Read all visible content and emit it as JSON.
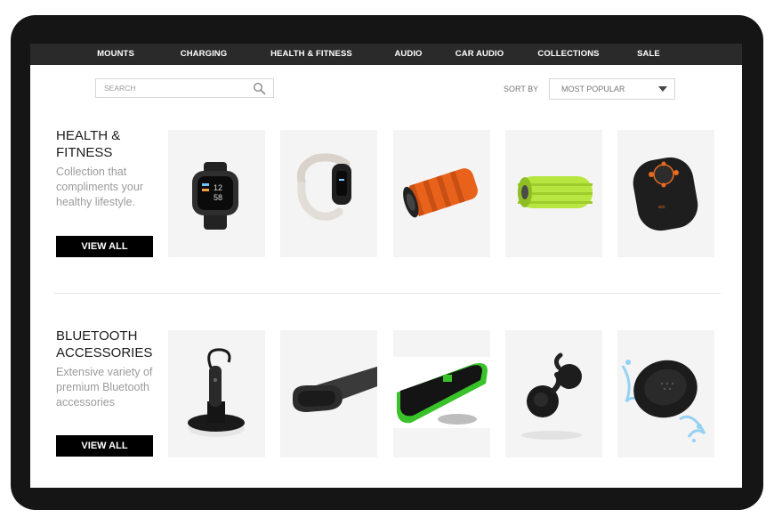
{
  "nav": {
    "items": [
      "MOUNTS",
      "CHARGING",
      "HEALTH & FITNESS",
      "AUDIO",
      "CAR AUDIO",
      "COLLECTIONS",
      "SALE"
    ]
  },
  "search": {
    "placeholder": "SEARCH"
  },
  "sort": {
    "label": "SORT BY",
    "selected": "MOST POPULAR"
  },
  "sections": [
    {
      "title_line1": "HEALTH &",
      "title_line2": "FITNESS",
      "desc_lines": [
        "Collection that",
        "compliments your",
        "healthy lifestyle."
      ],
      "button": "VIEW ALL",
      "products": [
        "smartwatch-image",
        "fitness-band-image",
        "orange-foam-roller-image",
        "green-foam-roller-image",
        "portable-speaker-image"
      ]
    },
    {
      "title_line1": "BLUETOOTH",
      "title_line2": "ACCESSORIES",
      "desc_lines": [
        "Extensive variety of",
        "premium Bluetooth",
        "accessories"
      ],
      "button": "VIEW ALL",
      "products": [
        "bluetooth-headset-image",
        "armband-tracker-image",
        "green-phone-mount-image",
        "wireless-earbuds-image",
        "splash-speaker-image"
      ]
    }
  ],
  "colors": {
    "nav_bg": "#2a2a2a",
    "frame": "#151515",
    "button_bg": "#000000",
    "card_bg": "#f4f4f4",
    "accent_orange": "#e8621c",
    "accent_green": "#b8e640"
  }
}
